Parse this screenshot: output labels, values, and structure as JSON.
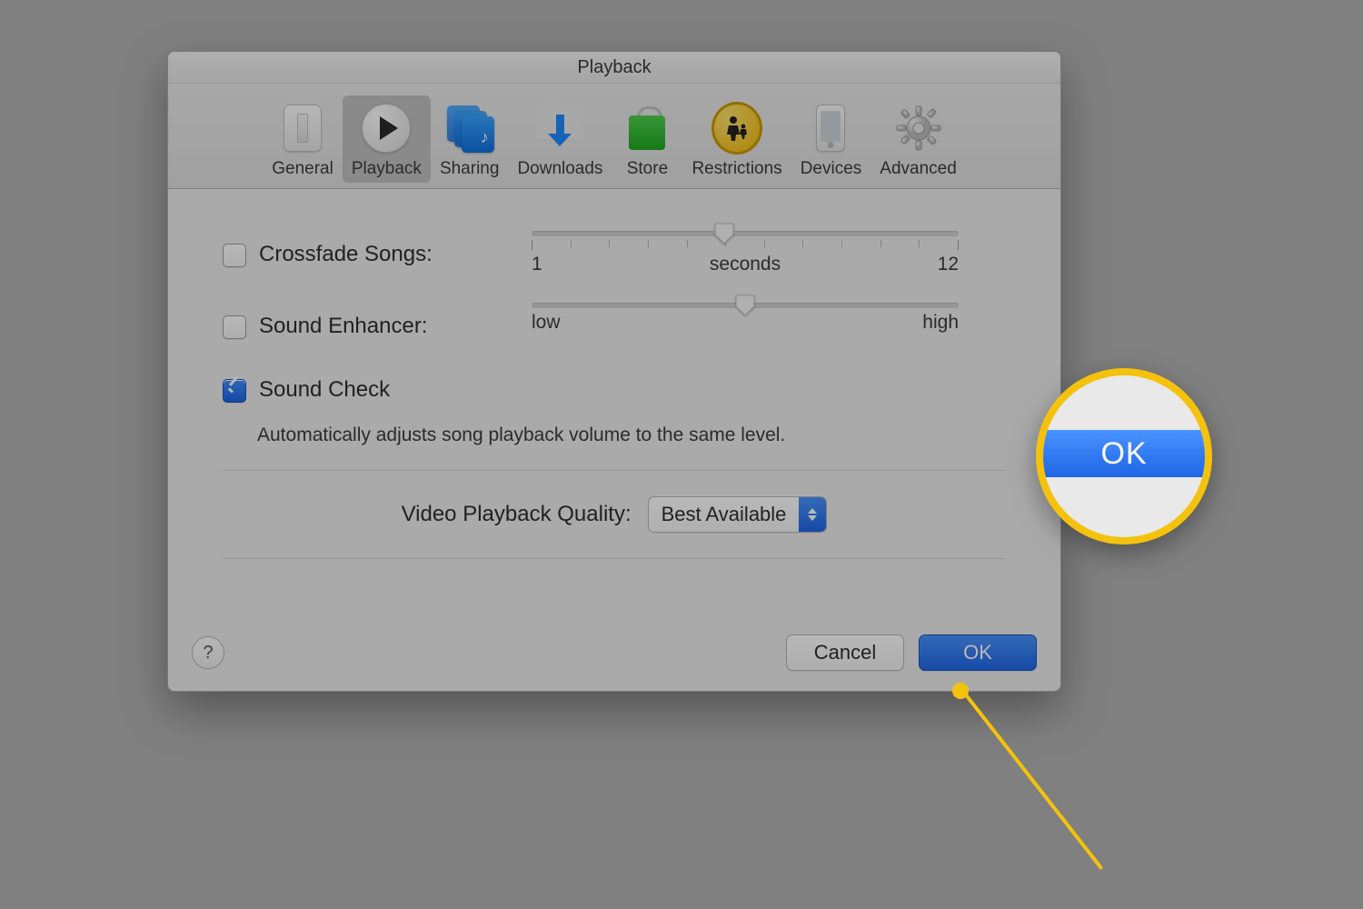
{
  "window": {
    "title": "Playback"
  },
  "toolbar": {
    "selected": "playback",
    "items": [
      {
        "id": "general",
        "label": "General"
      },
      {
        "id": "playback",
        "label": "Playback"
      },
      {
        "id": "sharing",
        "label": "Sharing"
      },
      {
        "id": "downloads",
        "label": "Downloads"
      },
      {
        "id": "store",
        "label": "Store"
      },
      {
        "id": "restrictions",
        "label": "Restrictions"
      },
      {
        "id": "devices",
        "label": "Devices"
      },
      {
        "id": "advanced",
        "label": "Advanced"
      }
    ]
  },
  "options": {
    "crossfade": {
      "label": "Crossfade Songs:",
      "checked": false,
      "slider": {
        "min_label": "1",
        "max_label": "12",
        "mid_label": "seconds",
        "value_pct": 45
      }
    },
    "enhancer": {
      "label": "Sound Enhancer:",
      "checked": false,
      "slider": {
        "min_label": "low",
        "max_label": "high",
        "value_pct": 50
      }
    },
    "sound_check": {
      "label": "Sound Check",
      "checked": true,
      "description": "Automatically adjusts song playback volume to the same level."
    }
  },
  "video_quality": {
    "label": "Video Playback Quality:",
    "value": "Best Available"
  },
  "buttons": {
    "help": "?",
    "cancel": "Cancel",
    "ok": "OK"
  },
  "callout": {
    "text": "OK"
  }
}
